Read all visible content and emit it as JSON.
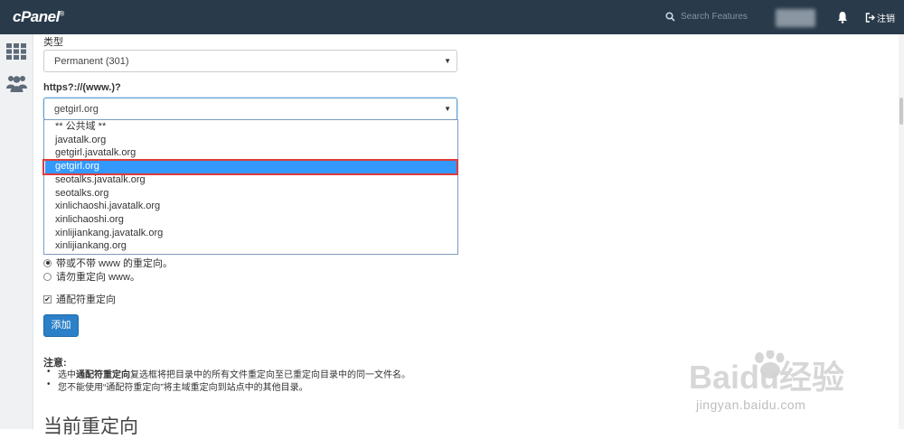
{
  "header": {
    "logo": "cPanel",
    "search_placeholder": "Search Features",
    "logout_label": "注销"
  },
  "form": {
    "type_label": "类型",
    "type_value": "Permanent (301)",
    "https_label": "https?://(www.)?",
    "domain_value": "getgirl.org",
    "domain_options": [
      "** 公共域 **",
      "javatalk.org",
      "getgirl.javatalk.org",
      "getgirl.org",
      "seotalks.javatalk.org",
      "seotalks.org",
      "xinlichaoshi.javatalk.org",
      "xinlichaoshi.org",
      "xinlijiankang.javatalk.org",
      "xinlijiankang.org"
    ],
    "highlighted_option_index": 3,
    "radio_with_www": "带或不带 www 的重定向。",
    "radio_no_www": "请勿重定向 www。",
    "wildcard_label": "通配符重定向",
    "add_button": "添加"
  },
  "notes": {
    "title": "注意:",
    "line1_pre": "选中",
    "line1_bold": "通配符重定向",
    "line1_post": "复选框将把目录中的所有文件重定向至已重定向目录中的同一文件名。",
    "line2": "您不能使用“通配符重定向”将主域重定向到站点中的其他目录。"
  },
  "section_title": "当前重定向",
  "watermark": {
    "brand": "Baidu经验",
    "url": "jingyan.baidu.com"
  },
  "colors": {
    "topbar": "#293a4a",
    "highlight": "#3399ff",
    "button": "#2b80c8",
    "annotation_frame": "#e03b3b"
  }
}
